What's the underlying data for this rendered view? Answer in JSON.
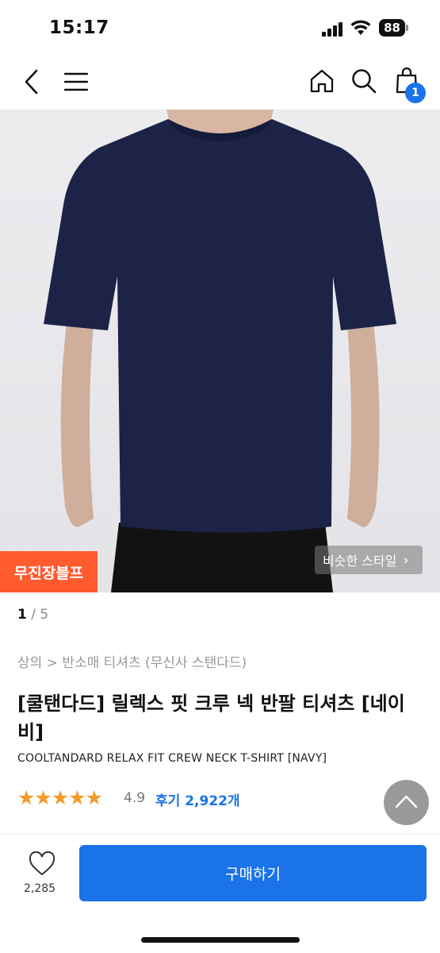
{
  "status": {
    "time": "15:17",
    "battery": "88"
  },
  "nav": {
    "cart_count": "1"
  },
  "product": {
    "promo_tag": "무진장블프",
    "similar_style": "비슷한 스타일",
    "page_current": "1",
    "page_total": "5",
    "breadcrumb": "상의 > 반소매 티셔츠 (무신사 스탠다드)",
    "title": "[쿨탠다드] 릴렉스 핏 크루 넥 반팔 티셔츠 [네이비]",
    "subtitle": "COOLTANDARD RELAX FIT CREW NECK T-SHIRT [NAVY]",
    "stars": "★★★★★",
    "rating": "4.9",
    "reviews": "후기 2,922개",
    "shirt_color": "#1c2347"
  },
  "bottom": {
    "like_count": "2,285",
    "buy_label": "구매하기"
  },
  "colors": {
    "accent": "#1a73e8",
    "promo": "#ff5b2e",
    "star": "#f39a27"
  }
}
